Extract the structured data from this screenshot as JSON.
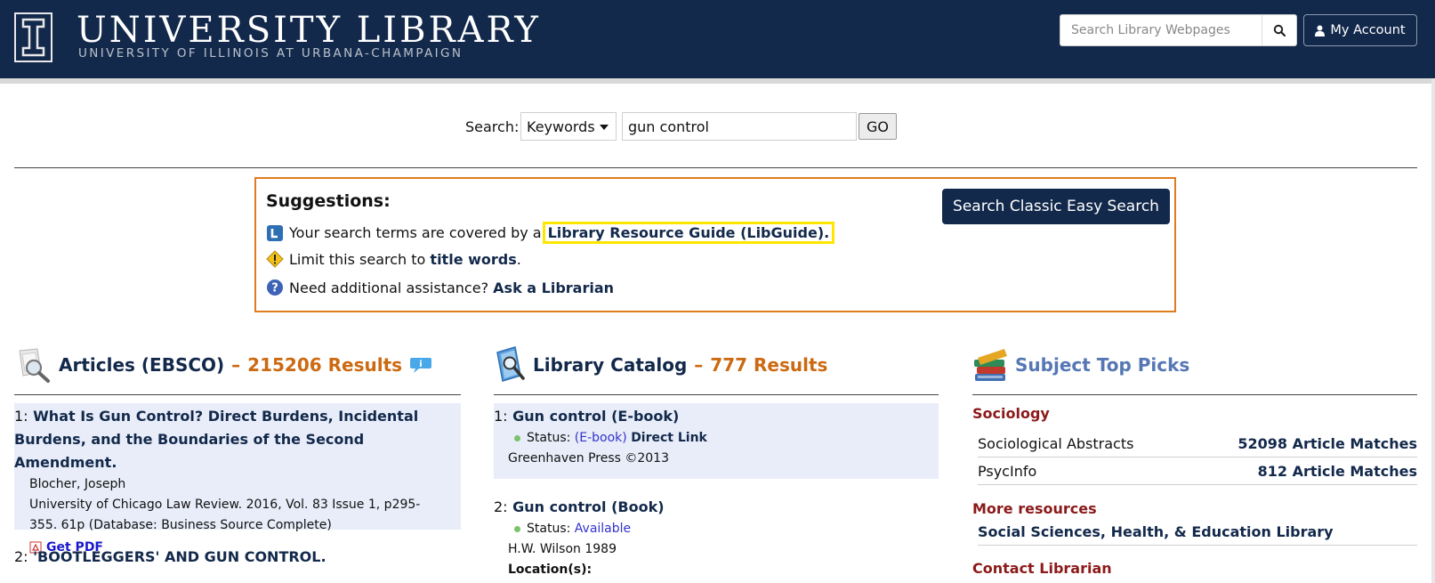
{
  "header": {
    "logo_title": "UNIVERSITY LIBRARY",
    "logo_subtitle": "UNIVERSITY OF ILLINOIS AT URBANA-CHAMPAIGN",
    "site_search_placeholder": "Search Library Webpages",
    "account_label": "My Account",
    "colors": {
      "navy": "#13294b",
      "orange": "#e07b1e"
    }
  },
  "search": {
    "label": "Search:",
    "scope_selected": "Keywords",
    "query": "gun control",
    "go_label": "GO"
  },
  "suggestions": {
    "title": "Suggestions:",
    "classic_button": "Search Classic Easy Search",
    "rows": [
      {
        "icon": "libguide-icon",
        "prefix": "Your search terms are covered by a",
        "link": "Library Resource Guide (LibGuide).",
        "suffix": ""
      },
      {
        "icon": "warning-icon",
        "prefix": "Limit this search to",
        "link": "title words",
        "suffix": "."
      },
      {
        "icon": "help-icon",
        "prefix": "Need additional assistance?",
        "link": "Ask a Librarian",
        "suffix": ""
      }
    ]
  },
  "articles": {
    "title": "Articles (EBSCO)",
    "sep": "–",
    "count": "215206 Results",
    "results": [
      {
        "num": "1:",
        "title": "What Is Gun Control? Direct Burdens, Incidental Burdens, and the Boundaries of the Second Amendment.",
        "author": "Blocher, Joseph",
        "source": "University of Chicago Law Review. 2016, Vol. 83 Issue 1, p295-355. 61p (Database: Business Source Complete)",
        "pdf": "Get PDF"
      },
      {
        "num": "2:",
        "title": "'BOOTLEGGERS' AND GUN CONTROL."
      }
    ]
  },
  "catalog": {
    "title": "Library Catalog",
    "sep": "–",
    "count": "777 Results",
    "results": [
      {
        "num": "1:",
        "title": "Gun control (E-book)",
        "status_label": "Status:",
        "status_value": "(E-book)",
        "status_link": "Direct Link",
        "publisher": "Greenhaven Press ©2013"
      },
      {
        "num": "2:",
        "title": "Gun control (Book)",
        "status_label": "Status:",
        "status_value": "Available",
        "publisher": "H.W. Wilson 1989",
        "location_label": "Location(s):"
      }
    ]
  },
  "picks": {
    "title": "Subject Top Picks",
    "section1": "Sociology",
    "rows": [
      {
        "name": "Sociological Abstracts",
        "matches": "52098 Article Matches"
      },
      {
        "name": "PsycInfo",
        "matches": "812 Article Matches"
      }
    ],
    "section2": "More resources",
    "more_link": "Social Sciences, Health, & Education Library",
    "section3": "Contact Librarian"
  }
}
